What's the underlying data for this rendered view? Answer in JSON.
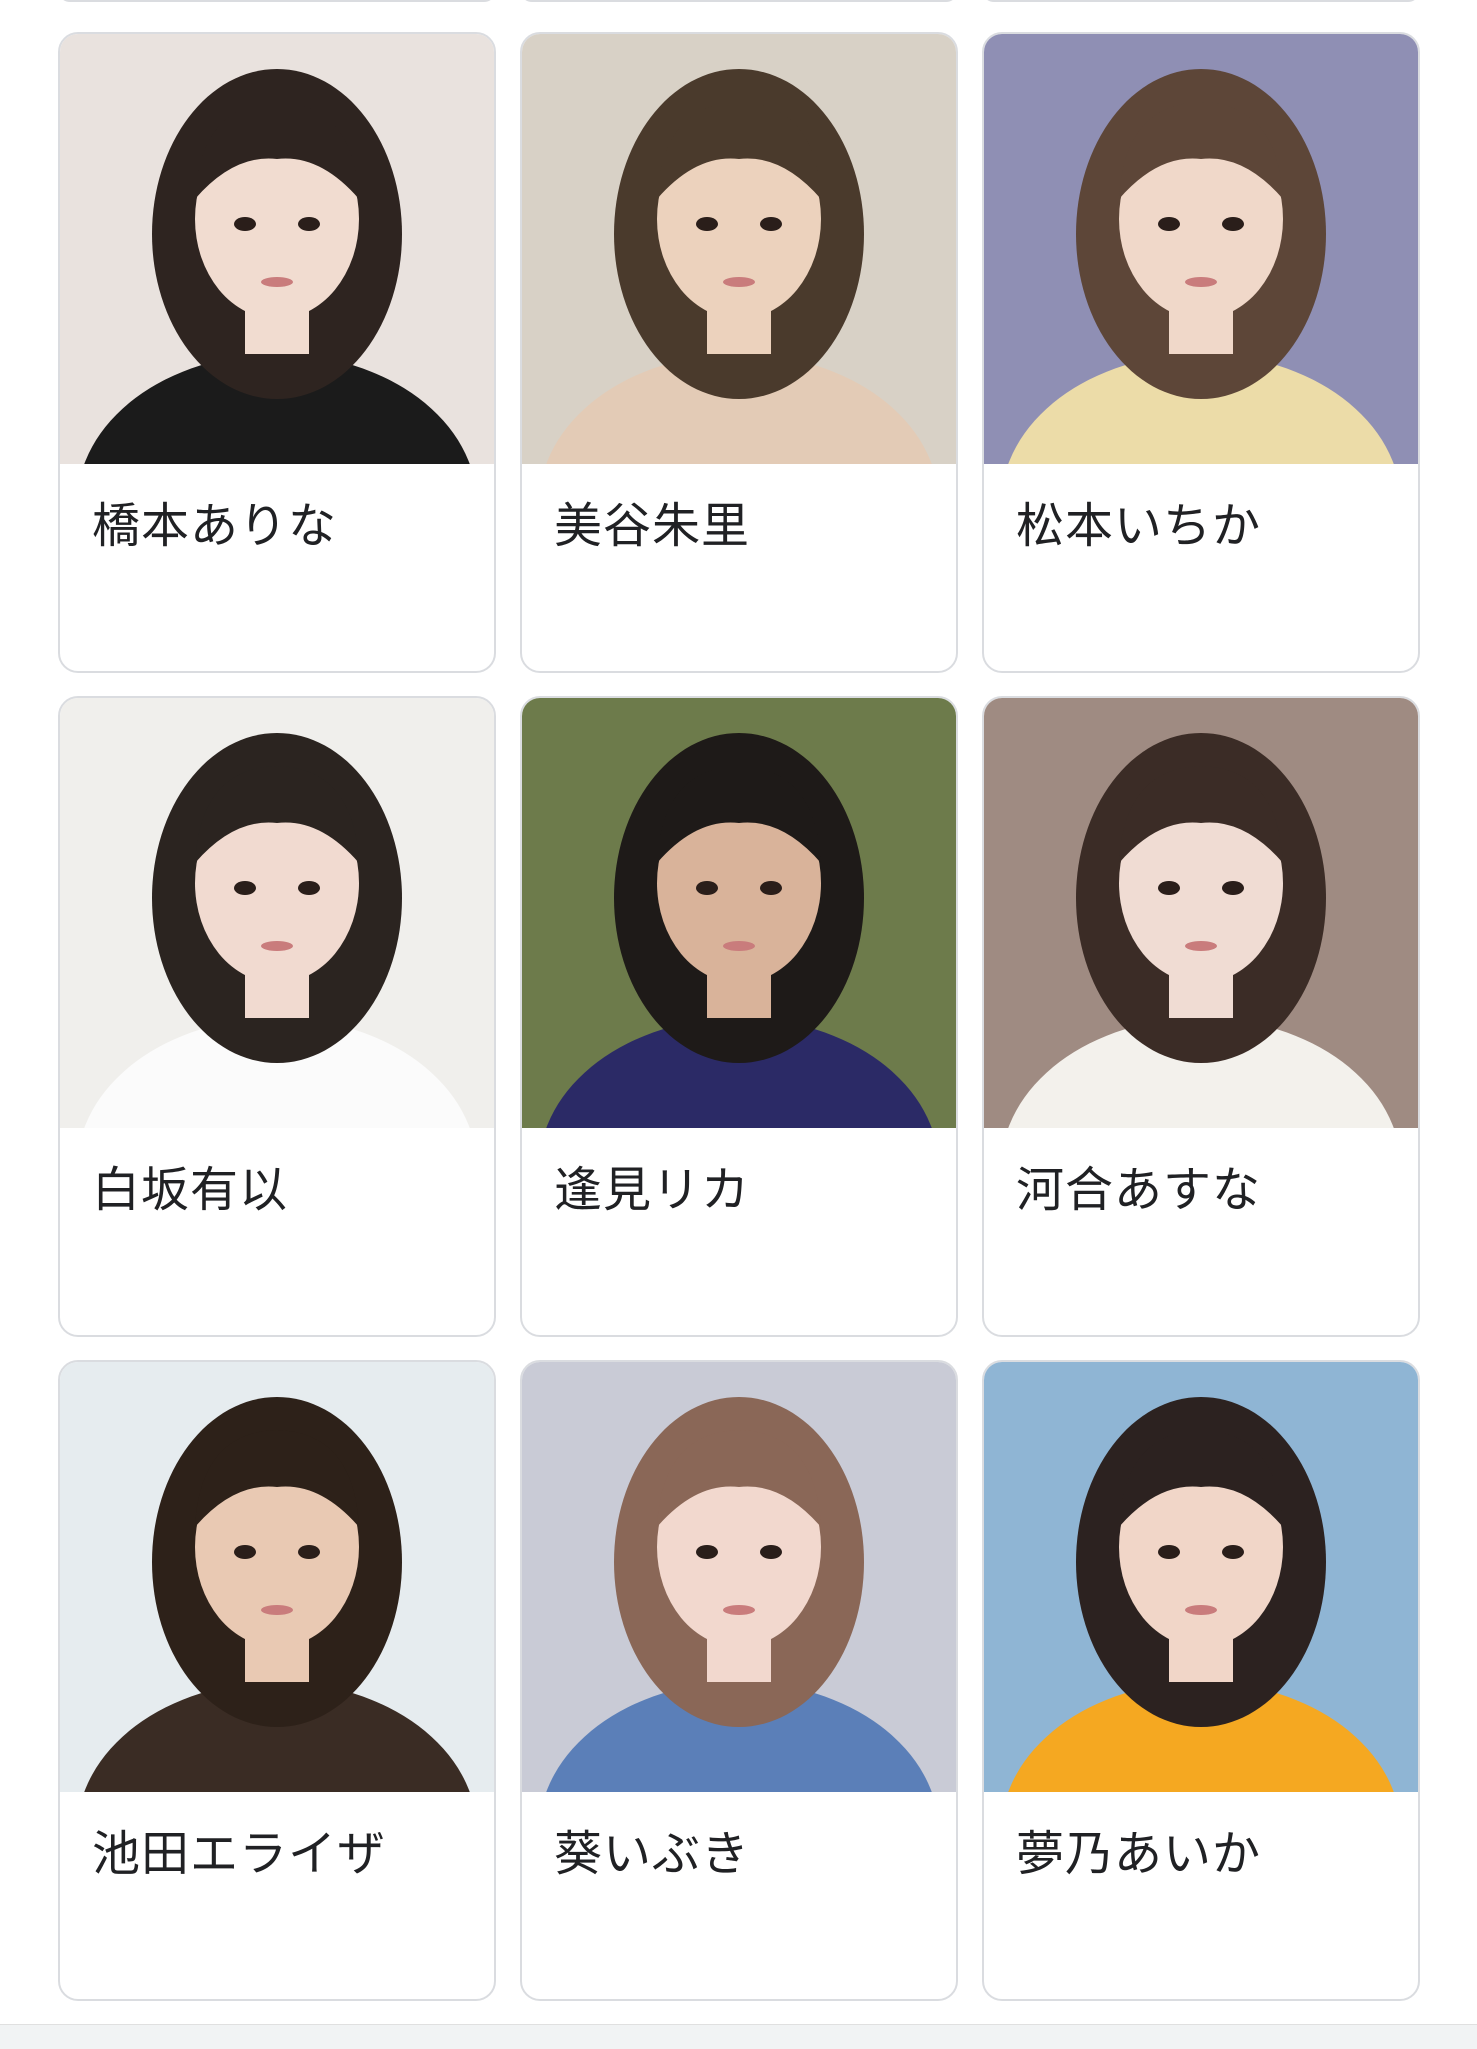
{
  "results": [
    {
      "name": "橋本ありな",
      "thumb_bg": "#e9e2de",
      "hair": "#2e2420",
      "skin": "#f1dcd0",
      "cloth": "#1b1b1b"
    },
    {
      "name": "美谷朱里",
      "thumb_bg": "#d8d1c6",
      "hair": "#4a3a2c",
      "skin": "#ecd2bd",
      "cloth": "#e3cbb6"
    },
    {
      "name": "松本いちか",
      "thumb_bg": "#8f8fb4",
      "hair": "#5d4638",
      "skin": "#f0d8c9",
      "cloth": "#ecdca8"
    },
    {
      "name": "白坂有以",
      "thumb_bg": "#f0efec",
      "hair": "#2b2420",
      "skin": "#f1dad0",
      "cloth": "#fbfbfb"
    },
    {
      "name": "逢見リカ",
      "thumb_bg": "#6d7b4b",
      "hair": "#1e1a18",
      "skin": "#d9b39a",
      "cloth": "#2b2a66"
    },
    {
      "name": "河合あすな",
      "thumb_bg": "#9f8b82",
      "hair": "#3b2c26",
      "skin": "#f0dcd3",
      "cloth": "#f3f1ec"
    },
    {
      "name": "池田エライザ",
      "thumb_bg": "#e6ecef",
      "hair": "#2d2119",
      "skin": "#e9c9b3",
      "cloth": "#3a2c24"
    },
    {
      "name": "葵いぶき",
      "thumb_bg": "#c9cbd6",
      "hair": "#8a6757",
      "skin": "#f2d8ce",
      "cloth": "#5b7fb8"
    },
    {
      "name": "夢乃あいか",
      "thumb_bg": "#8fb5d4",
      "hair": "#2c2220",
      "skin": "#f1d6c8",
      "cloth": "#f5a821"
    }
  ]
}
